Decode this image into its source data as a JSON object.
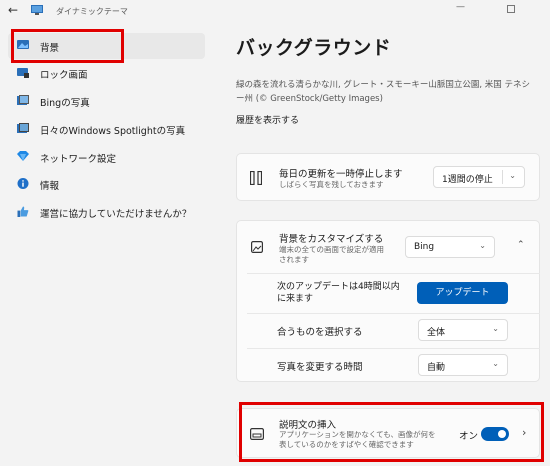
{
  "window": {
    "title": "ダイナミックテーマ",
    "minimize_glyph": "—",
    "back_glyph": "←"
  },
  "sidebar": {
    "items": [
      {
        "label": "背景",
        "icon": "desktop-background-icon"
      },
      {
        "label": "ロック画面",
        "icon": "lock-screen-icon"
      },
      {
        "label": "Bingの写真",
        "icon": "photo-icon"
      },
      {
        "label": "日々のWindows Spotlightの写真",
        "icon": "spotlight-icon"
      },
      {
        "label": "ネットワーク設定",
        "icon": "network-icon"
      },
      {
        "label": "情報",
        "icon": "info-icon"
      },
      {
        "label": "運営に協力していただけませんか？",
        "icon": "thumbs-up-icon"
      }
    ]
  },
  "main": {
    "title": "バックグラウンド",
    "caption": "緑の森を流れる清らかな川, グレート・スモーキー山脈国立公園, 米国 テネシー州 (© GreenStock/Getty Images)",
    "history_link": "履歴を表示する",
    "pause": {
      "title": "毎日の更新を一時停止します",
      "subtitle": "しばらく写真を残しておきます",
      "value": "1週間の停止"
    },
    "customize": {
      "title": "背景をカスタマイズする",
      "subtitle": "端末の全ての画面で設定が適用されます",
      "value": "Bing",
      "next_update": "次のアップデートは4時間以内に来ます",
      "update_button": "アップデート",
      "fit_label": "合うものを選択する",
      "fit_value": "全体",
      "change_time_label": "写真を変更する時間",
      "change_time_value": "自動"
    },
    "description": {
      "title": "説明文の挿入",
      "subtitle": "アプリケーションを開かなくても、画像が何を表しているのかをすばやく確認できます",
      "state": "オン",
      "on": true
    }
  },
  "colors": {
    "accent": "#005fb8",
    "highlight": "#e00000"
  }
}
